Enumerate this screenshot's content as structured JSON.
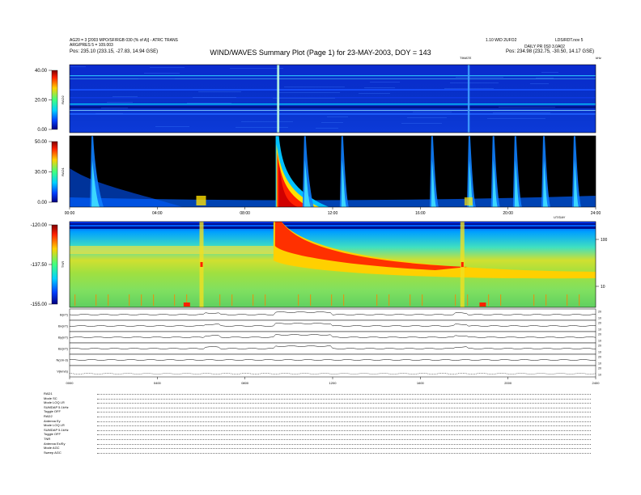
{
  "header": {
    "title": "WIND/WAVES Summary Plot (Page 1) for 23-MAY-2003, DOY = 143",
    "top_left_1": "AG20 = 3 [2003 MPO/SF/RGB 030 (% of A)] - ATRC TRANS",
    "top_left_2": "ARG/PRES 5 = 109.003",
    "top_left_3": "Pos:    235.10 (233.15, -27.83, 14.94 GSE)",
    "top_right_1": "1.10 WID 2UFO2",
    "top_right_2": "LDS/RDT.nov 5",
    "top_right_3": "DAILY PR 0S0 3.0A02",
    "top_right_4": "Pos:    234.98 (232.75, -30.50, 14.17 GSE)",
    "time_label_left": "TIMATE",
    "time_label_right": "kHz"
  },
  "chart_data": [
    {
      "type": "heatmap",
      "name": "RAD2",
      "colorbar_ticks": [
        "40.00",
        "20.00",
        "0.00"
      ],
      "features": [
        {
          "time_h": 9.5,
          "intensity": 1.0,
          "decay_h": 0.2
        },
        {
          "time_h": 18.2,
          "intensity": 0.5,
          "decay_h": 0.1
        }
      ]
    },
    {
      "type": "heatmap",
      "name": "RAD1",
      "colorbar_ticks": [
        "50.00",
        "30.00",
        "0.00"
      ],
      "features": [
        {
          "time_h": 9.4,
          "intensity": 1.0,
          "decay_h": 1.5
        },
        {
          "time_h": 10.7,
          "intensity": 0.6,
          "decay_h": 0.4
        },
        {
          "time_h": 12.4,
          "intensity": 0.4,
          "decay_h": 0.3
        },
        {
          "time_h": 16.5,
          "intensity": 0.5,
          "decay_h": 0.3
        },
        {
          "time_h": 18.2,
          "intensity": 0.6,
          "decay_h": 0.3
        },
        {
          "time_h": 19.3,
          "intensity": 0.5,
          "decay_h": 0.3
        },
        {
          "time_h": 20.3,
          "intensity": 0.5,
          "decay_h": 0.3
        },
        {
          "time_h": 21.6,
          "intensity": 0.4,
          "decay_h": 0.3
        },
        {
          "time_h": 23.0,
          "intensity": 0.4,
          "decay_h": 0.3
        },
        {
          "time_h": 1.0,
          "intensity": 0.4,
          "decay_h": 0.5
        }
      ],
      "x_tick_labels": [
        "00:00",
        "04:00",
        "08:00",
        "12:00",
        "16:00",
        "20:00",
        "24:00"
      ],
      "x_unit": "UT/DAY"
    },
    {
      "type": "heatmap",
      "name": "TNR",
      "colorbar_ticks": [
        "-120.00",
        "-137.50",
        "-155.00"
      ],
      "right_ticks": [
        "100",
        "10"
      ],
      "features": [
        {
          "time_h": 9.3,
          "intensity": 1.0,
          "decay_h": 6.0
        },
        {
          "time_h": 6.0,
          "intensity": 0.5,
          "decay_h": 0.2
        },
        {
          "time_h": 17.9,
          "intensity": 0.6,
          "decay_h": 0.2
        }
      ]
    },
    {
      "type": "line",
      "name": "mag-field-traces",
      "rows": [
        {
          "label": "B(nT)",
          "right_ticks": [
            "20",
            "10"
          ]
        },
        {
          "label": "Bx(nT)",
          "right_ticks": [
            "20",
            "10"
          ]
        },
        {
          "label": "By(nT)",
          "right_ticks": [
            "20",
            "10"
          ]
        },
        {
          "label": "Bz(nT)",
          "right_ticks": [
            "20",
            "10"
          ]
        },
        {
          "label": "N(cm-3)",
          "right_ticks": [
            "20",
            "10"
          ]
        },
        {
          "label": "V(km/s)",
          "right_ticks": [
            "20",
            "10"
          ]
        }
      ],
      "x_tick_labels": [
        "0000",
        "0400",
        "0800",
        "1200",
        "1600",
        "2000",
        "2400"
      ]
    }
  ],
  "footer": {
    "lines": [
      "RAD1",
      "Mode    SC",
      "Mode    LOQ LR",
      "SUMDAP 5.1kHz",
      "Toggle   OFF",
      "RAD2",
      "Antenna  Ey",
      "Mode    LOQ LR",
      "SUMDAP 5.1kHz",
      "Toggle   OFF",
      "TNR",
      "Antenna  Ex/Ey",
      "Mode    AGC",
      "Sweep   AGC"
    ]
  }
}
